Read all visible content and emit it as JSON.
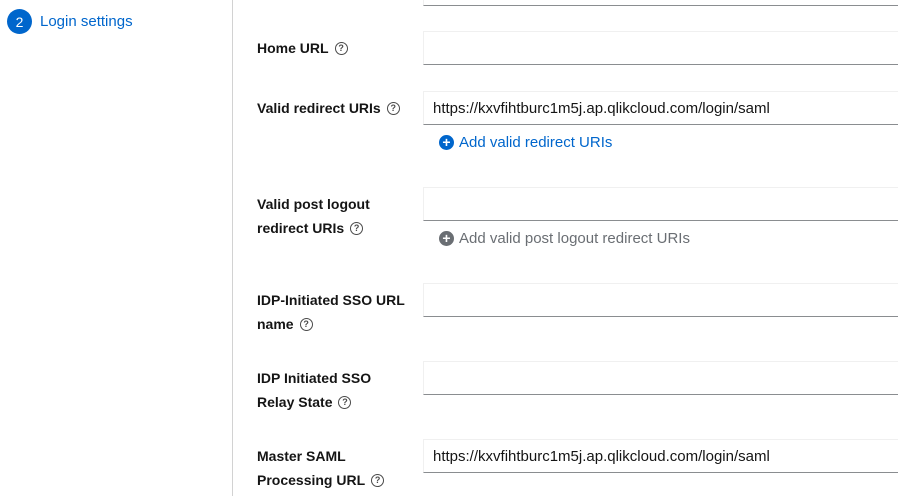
{
  "sidebar": {
    "step_number": "2",
    "step_label": "Login settings"
  },
  "fields": {
    "home_url": {
      "label": "Home URL",
      "value": ""
    },
    "valid_redirect_uris": {
      "label": "Valid redirect URIs",
      "value": "https://kxvfihtburc1m5j.ap.qlikcloud.com/login/saml",
      "add_label": "Add valid redirect URIs"
    },
    "valid_post_logout": {
      "label_line1": "Valid post logout",
      "label_line2": "redirect URIs",
      "value": "",
      "add_label": "Add valid post logout redirect URIs"
    },
    "idp_sso_url_name": {
      "label_line1": "IDP-Initiated SSO URL",
      "label_line2": "name",
      "value": ""
    },
    "idp_relay_state": {
      "label_line1": "IDP Initiated SSO",
      "label_line2": "Relay State",
      "value": ""
    },
    "master_saml_url": {
      "label_line1": "Master SAML",
      "label_line2": "Processing URL",
      "value": "https://kxvfihtburc1m5j.ap.qlikcloud.com/login/saml"
    }
  },
  "icons": {
    "help": "?",
    "plus": "+"
  },
  "colors": {
    "accent": "#0066cc",
    "disabled": "#6a6e73",
    "divider": "#d2d2d2"
  }
}
